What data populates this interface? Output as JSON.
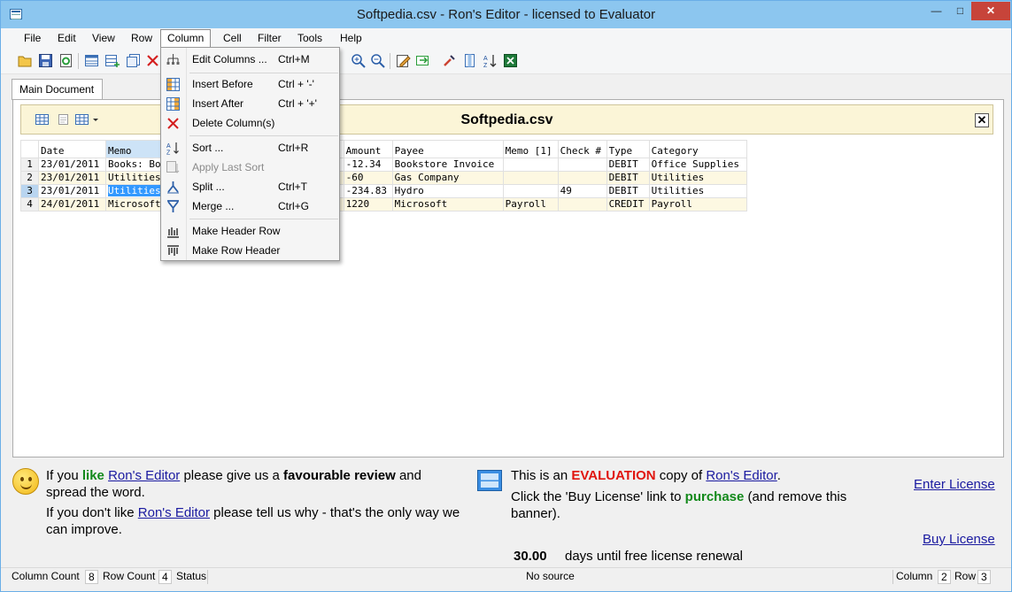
{
  "window": {
    "title": "Softpedia.csv - Ron's Editor - licensed to Evaluator"
  },
  "menubar": [
    "File",
    "Edit",
    "View",
    "Row",
    "Column",
    "Cell",
    "Filter",
    "Tools",
    "Help"
  ],
  "tab": {
    "label": "Main Document"
  },
  "document": {
    "title": "Softpedia.csv"
  },
  "table": {
    "columns": [
      "Date",
      "Memo",
      "",
      "Amount",
      "Payee",
      "Memo [1]",
      "Check #",
      "Type",
      "Category"
    ],
    "rows": [
      {
        "num": "1",
        "cells": [
          "23/01/2011",
          "Books: Bo",
          "",
          "-12.34",
          "Bookstore Invoice",
          "",
          "",
          "DEBIT",
          "Office Supplies"
        ]
      },
      {
        "num": "2",
        "cells": [
          "23/01/2011",
          "Utilities",
          "",
          "-60",
          "Gas Company",
          "",
          "",
          "DEBIT",
          "Utilities"
        ]
      },
      {
        "num": "3",
        "cells": [
          "23/01/2011",
          "Utilities",
          "",
          "-234.83",
          "Hydro",
          "",
          "49",
          "DEBIT",
          "Utilities"
        ]
      },
      {
        "num": "4",
        "cells": [
          "24/01/2011",
          "Microsoft",
          "",
          "1220",
          "Microsoft",
          "Payroll",
          "",
          "CREDIT",
          "Payroll"
        ]
      }
    ]
  },
  "column_menu": {
    "items": [
      {
        "label": "Edit Columns ...",
        "shortcut": "Ctrl+M",
        "icon": "edit-columns-icon"
      },
      {
        "label": "Insert Before",
        "shortcut": "Ctrl + '-'",
        "icon": "insert-before-icon"
      },
      {
        "label": "Insert After",
        "shortcut": "Ctrl + '+'",
        "icon": "insert-after-icon"
      },
      {
        "label": "Delete Column(s)",
        "shortcut": "",
        "icon": "delete-x-icon"
      },
      {
        "label": "Sort ...",
        "shortcut": "Ctrl+R",
        "icon": "sort-az-icon"
      },
      {
        "label": "Apply Last Sort",
        "shortcut": "",
        "icon": "apply-sort-icon",
        "disabled": true
      },
      {
        "label": "Split ...",
        "shortcut": "Ctrl+T",
        "icon": "split-icon"
      },
      {
        "label": "Merge ...",
        "shortcut": "Ctrl+G",
        "icon": "merge-icon"
      },
      {
        "label": "Make Header Row",
        "shortcut": "",
        "icon": "header-row-icon"
      },
      {
        "label": "Make Row Header",
        "shortcut": "",
        "icon": "row-header-icon"
      }
    ]
  },
  "banner": {
    "left": {
      "l1a": "If you ",
      "l1b": "like",
      "l1c": " ",
      "l1link": "Ron's Editor",
      "l1d": " please give us a ",
      "l1e": "favourable review",
      "l1f": " and",
      "l2": "spread the word.",
      "l3a": "If you don't like ",
      "l3link": "Ron's Editor",
      "l3b": " please tell us why - that's the only way we",
      "l4": "can improve."
    },
    "right": {
      "l1a": "This is an ",
      "l1b": "EVALUATION",
      "l1c": " copy of ",
      "l1link": "Ron's Editor",
      "l1d": ".",
      "l2a": "Click the 'Buy License' link to ",
      "l2b": "purchase",
      "l2c": " (and remove this",
      "l3": "banner).",
      "days_value": "30.00",
      "days_text": "days until free license renewal"
    },
    "enter_license": "Enter License",
    "buy_license": "Buy License"
  },
  "statusbar": {
    "column_count_label": "Column Count",
    "column_count": "8",
    "row_count_label": "Row Count",
    "row_count": "4",
    "status_label": "Status",
    "source": "No source",
    "column_label": "Column",
    "column": "2",
    "row_label": "Row",
    "row": "3"
  }
}
